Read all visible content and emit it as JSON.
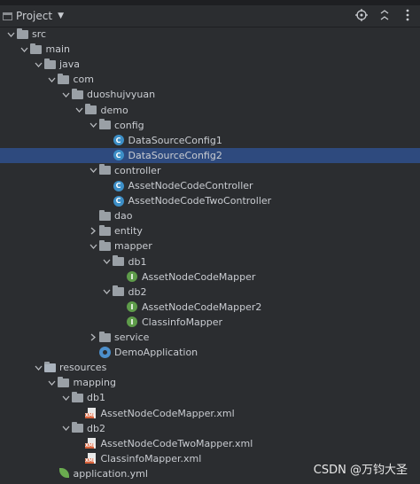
{
  "header": {
    "title": "Project"
  },
  "colors": {
    "background": "#2b2d30",
    "selection": "#2e4a7e",
    "class_icon": "#3d8fc7",
    "interface_icon": "#5e9c4a"
  },
  "tree": [
    {
      "label": "src",
      "depth": 0,
      "expanded": true,
      "icon": "folder-icon"
    },
    {
      "label": "main",
      "depth": 1,
      "expanded": true,
      "icon": "folder-icon"
    },
    {
      "label": "java",
      "depth": 2,
      "expanded": true,
      "icon": "folder-icon"
    },
    {
      "label": "com",
      "depth": 3,
      "expanded": true,
      "icon": "folder-icon"
    },
    {
      "label": "duoshujvyuan",
      "depth": 4,
      "expanded": true,
      "icon": "folder-icon"
    },
    {
      "label": "demo",
      "depth": 5,
      "expanded": true,
      "icon": "folder-icon"
    },
    {
      "label": "config",
      "depth": 6,
      "expanded": true,
      "icon": "folder-icon"
    },
    {
      "label": "DataSourceConfig1",
      "depth": 7,
      "icon": "class-icon"
    },
    {
      "label": "DataSourceConfig2",
      "depth": 7,
      "icon": "class-icon",
      "selected": true
    },
    {
      "label": "controller",
      "depth": 6,
      "expanded": true,
      "icon": "folder-icon"
    },
    {
      "label": "AssetNodeCodeController",
      "depth": 7,
      "icon": "class-icon"
    },
    {
      "label": "AssetNodeCodeTwoController",
      "depth": 7,
      "icon": "class-icon"
    },
    {
      "label": "dao",
      "depth": 6,
      "icon": "folder-icon"
    },
    {
      "label": "entity",
      "depth": 6,
      "expanded": false,
      "icon": "folder-icon"
    },
    {
      "label": "mapper",
      "depth": 6,
      "expanded": true,
      "icon": "folder-icon"
    },
    {
      "label": "db1",
      "depth": 7,
      "expanded": true,
      "icon": "folder-icon"
    },
    {
      "label": "AssetNodeCodeMapper",
      "depth": 8,
      "icon": "interface-icon"
    },
    {
      "label": "db2",
      "depth": 7,
      "expanded": true,
      "icon": "folder-icon"
    },
    {
      "label": "AssetNodeCodeMapper2",
      "depth": 8,
      "icon": "interface-icon"
    },
    {
      "label": "ClassinfoMapper",
      "depth": 8,
      "icon": "interface-icon"
    },
    {
      "label": "service",
      "depth": 6,
      "expanded": false,
      "icon": "folder-icon"
    },
    {
      "label": "DemoApplication",
      "depth": 6,
      "icon": "spring-boot-icon"
    },
    {
      "label": "resources",
      "depth": 2,
      "expanded": true,
      "icon": "resources-folder-icon"
    },
    {
      "label": "mapping",
      "depth": 3,
      "expanded": true,
      "icon": "folder-icon"
    },
    {
      "label": "db1",
      "depth": 4,
      "expanded": true,
      "icon": "folder-icon"
    },
    {
      "label": "AssetNodeCodeMapper.xml",
      "depth": 5,
      "icon": "xml-file-icon"
    },
    {
      "label": "db2",
      "depth": 4,
      "expanded": true,
      "icon": "folder-icon"
    },
    {
      "label": "AssetNodeCodeTwoMapper.xml",
      "depth": 5,
      "icon": "xml-file-icon"
    },
    {
      "label": "ClassinfoMapper.xml",
      "depth": 5,
      "icon": "xml-file-icon"
    },
    {
      "label": "application.yml",
      "depth": 3,
      "icon": "yaml-leaf-icon"
    }
  ],
  "watermark": "CSDN @万钧大圣"
}
